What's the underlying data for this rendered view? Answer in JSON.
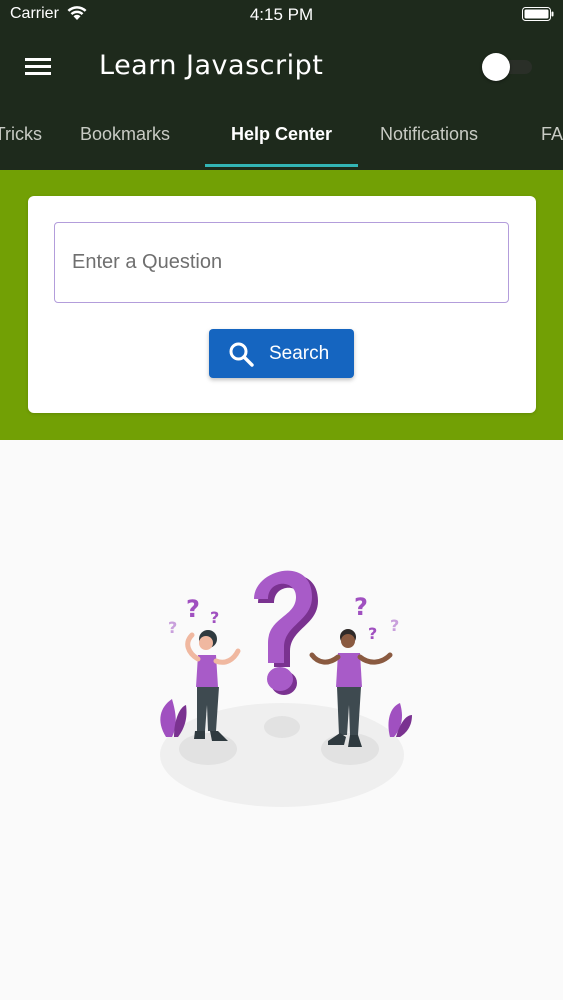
{
  "status_bar": {
    "carrier": "Carrier",
    "time": "4:15 PM"
  },
  "app_bar": {
    "title": "Learn Javascript",
    "theme_toggle_on": false
  },
  "tabs": [
    {
      "label": "Tricks",
      "active": false
    },
    {
      "label": "Bookmarks",
      "active": false
    },
    {
      "label": "Help Center",
      "active": true
    },
    {
      "label": "Notifications",
      "active": false
    },
    {
      "label": "FAQ",
      "active": false
    }
  ],
  "search": {
    "placeholder": "Enter a Question",
    "value": "",
    "button_label": "Search"
  },
  "colors": {
    "header": "#1e2a1c",
    "band": "#72a005",
    "button": "#1565c0",
    "tab_indicator": "#33b5b5",
    "illustration_accent": "#a050c0"
  },
  "illustration": {
    "icon": "confused-people-question-marks-illustration"
  }
}
